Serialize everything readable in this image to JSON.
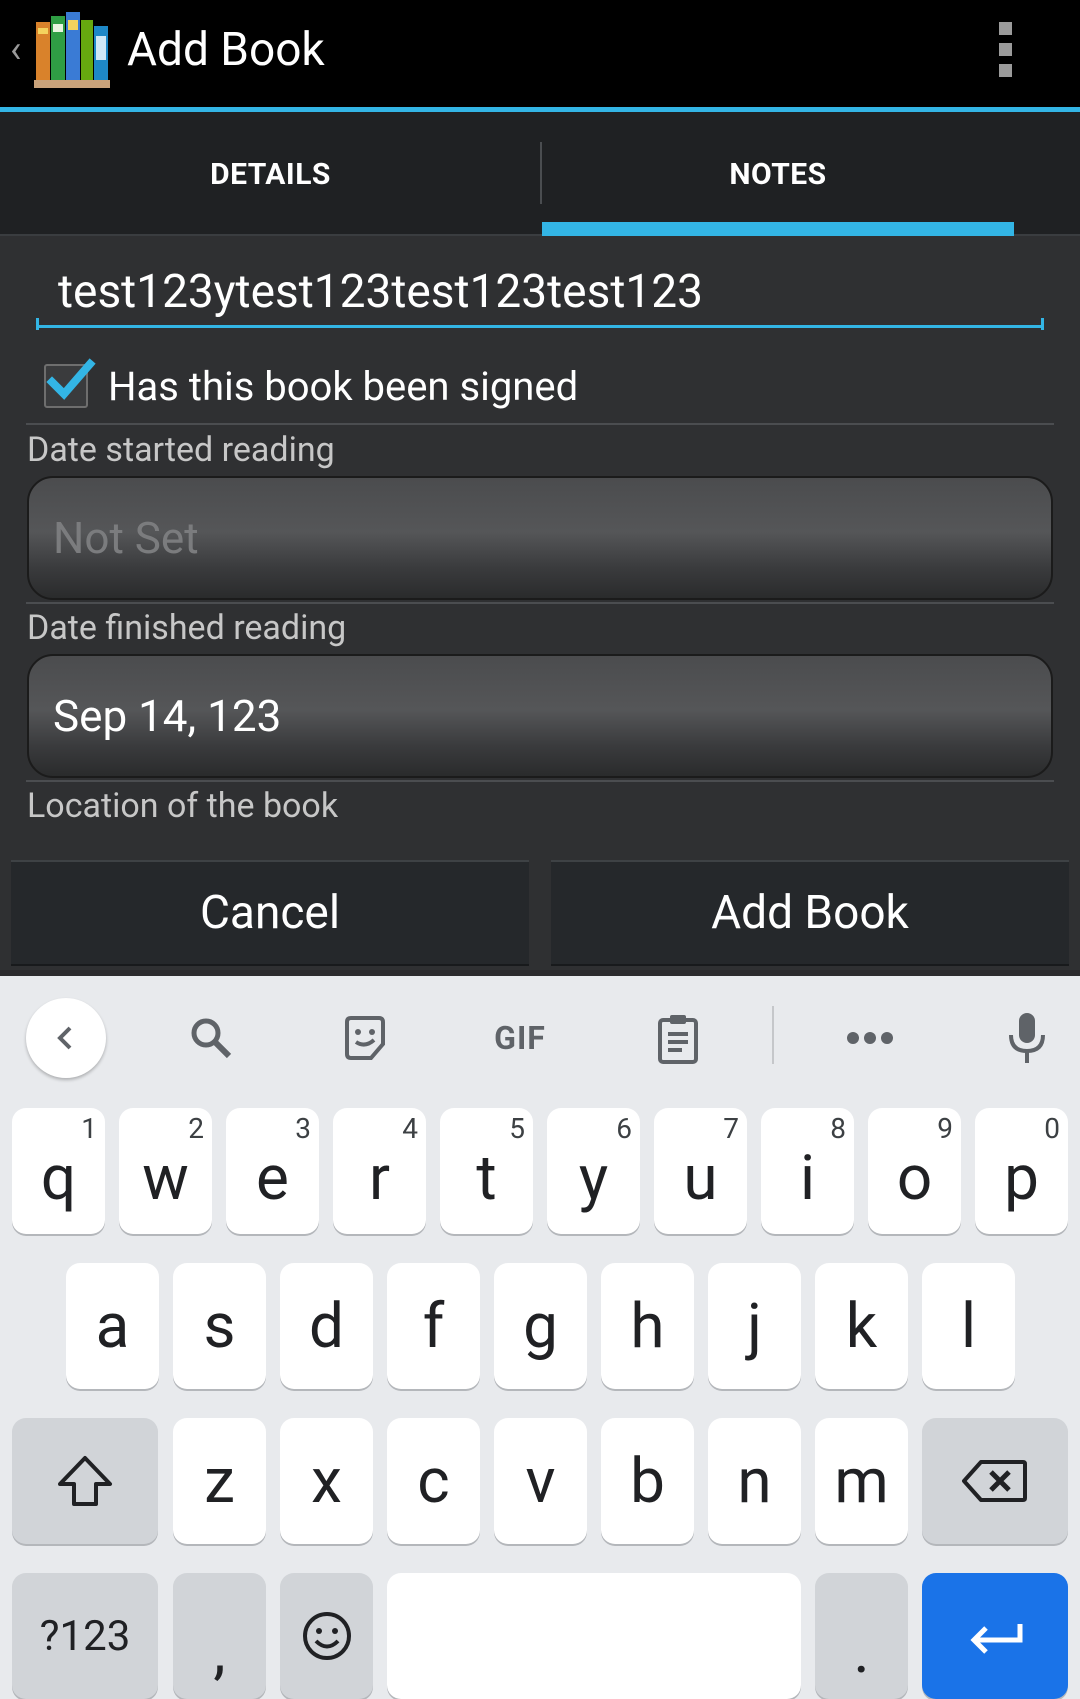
{
  "app": {
    "title": "Add Book",
    "accent_color": "#33b5e5"
  },
  "tabs": [
    {
      "label": "DETAILS",
      "active": false
    },
    {
      "label": "NOTES",
      "active": true
    }
  ],
  "form": {
    "notes_value": "test123ytest123test123test123",
    "signed_checkbox": {
      "label": "Has this book been signed",
      "checked": true
    },
    "date_started": {
      "label": "Date started reading",
      "value": "Not Set"
    },
    "date_finished": {
      "label": "Date finished reading",
      "value": "Sep 14, 123"
    },
    "location": {
      "label": "Location of the book"
    }
  },
  "actions": {
    "cancel_label": "Cancel",
    "add_label": "Add Book"
  },
  "keyboard": {
    "toolbar": {
      "back": "chevron-left-icon",
      "search": "search-icon",
      "sticker": "sticker-icon",
      "gif": "GIF",
      "clipboard": "clipboard-icon",
      "more": "more-horiz-icon",
      "mic": "mic-icon"
    },
    "row1": [
      {
        "key": "q",
        "hint": "1"
      },
      {
        "key": "w",
        "hint": "2"
      },
      {
        "key": "e",
        "hint": "3"
      },
      {
        "key": "r",
        "hint": "4"
      },
      {
        "key": "t",
        "hint": "5"
      },
      {
        "key": "y",
        "hint": "6"
      },
      {
        "key": "u",
        "hint": "7"
      },
      {
        "key": "i",
        "hint": "8"
      },
      {
        "key": "o",
        "hint": "9"
      },
      {
        "key": "p",
        "hint": "0"
      }
    ],
    "row2": [
      "a",
      "s",
      "d",
      "f",
      "g",
      "h",
      "j",
      "k",
      "l"
    ],
    "row3": [
      "z",
      "x",
      "c",
      "v",
      "b",
      "n",
      "m"
    ],
    "symbols_label": "?123",
    "comma": ",",
    "period": ".",
    "enter_color": "#1a73e8"
  }
}
